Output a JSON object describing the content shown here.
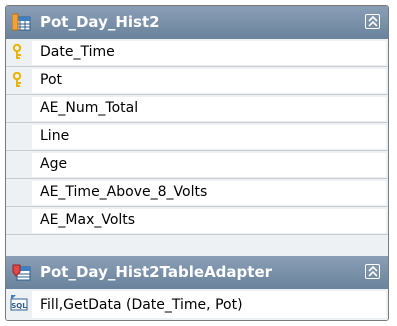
{
  "table": {
    "title": "Pot_Day_Hist2",
    "columns": [
      {
        "name": "Date_Time",
        "is_key": true
      },
      {
        "name": "Pot",
        "is_key": true
      },
      {
        "name": "AE_Num_Total",
        "is_key": false
      },
      {
        "name": "Line",
        "is_key": false
      },
      {
        "name": "Age",
        "is_key": false
      },
      {
        "name": "AE_Time_Above_8_Volts",
        "is_key": false
      },
      {
        "name": "AE_Max_Volts",
        "is_key": false
      }
    ]
  },
  "adapter": {
    "title": "Pot_Day_Hist2TableAdapter",
    "query": "Fill,GetData (Date_Time, Pot)",
    "query_icon_label": "SQL"
  },
  "colors": {
    "header": "#6a829c",
    "key": "#e8b400"
  }
}
